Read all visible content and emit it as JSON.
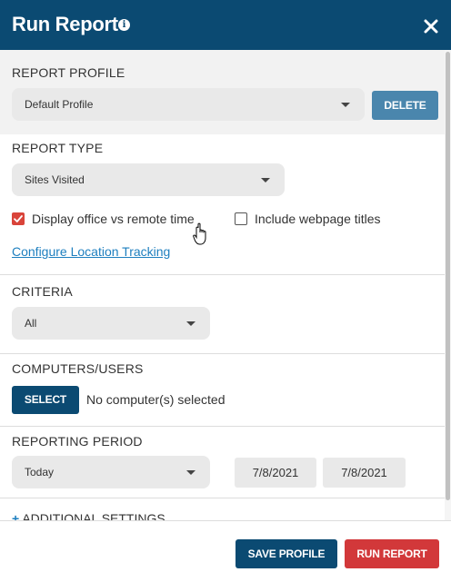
{
  "header": {
    "title": "Run Report",
    "info_icon": "i"
  },
  "report_profile": {
    "label": "REPORT PROFILE",
    "selected": "Default Profile",
    "delete_label": "DELETE"
  },
  "report_type": {
    "label": "REPORT TYPE",
    "selected": "Sites Visited",
    "option_office_remote": {
      "label": "Display office vs remote time",
      "checked": true
    },
    "option_webpage_titles": {
      "label": "Include webpage titles",
      "checked": false
    },
    "configure_link": "Configure Location Tracking"
  },
  "criteria": {
    "label": "CRITERIA",
    "selected": "All"
  },
  "computers": {
    "label": "COMPUTERS/USERS",
    "select_label": "SELECT",
    "status": "No computer(s) selected"
  },
  "reporting_period": {
    "label": "REPORTING PERIOD",
    "selected": "Today",
    "start_date": "7/8/2021",
    "end_date": "7/8/2021"
  },
  "additional_settings": {
    "plus": "+",
    "label": "ADDITIONAL SETTINGS"
  },
  "footer": {
    "save_profile_label": "SAVE PROFILE",
    "run_report_label": "RUN REPORT"
  },
  "colors": {
    "header": "#0b4a72",
    "delete": "#4a86ad",
    "save": "#0b4a72",
    "run": "#d2383a",
    "check": "#d9443a",
    "link": "#1e7fbf"
  }
}
